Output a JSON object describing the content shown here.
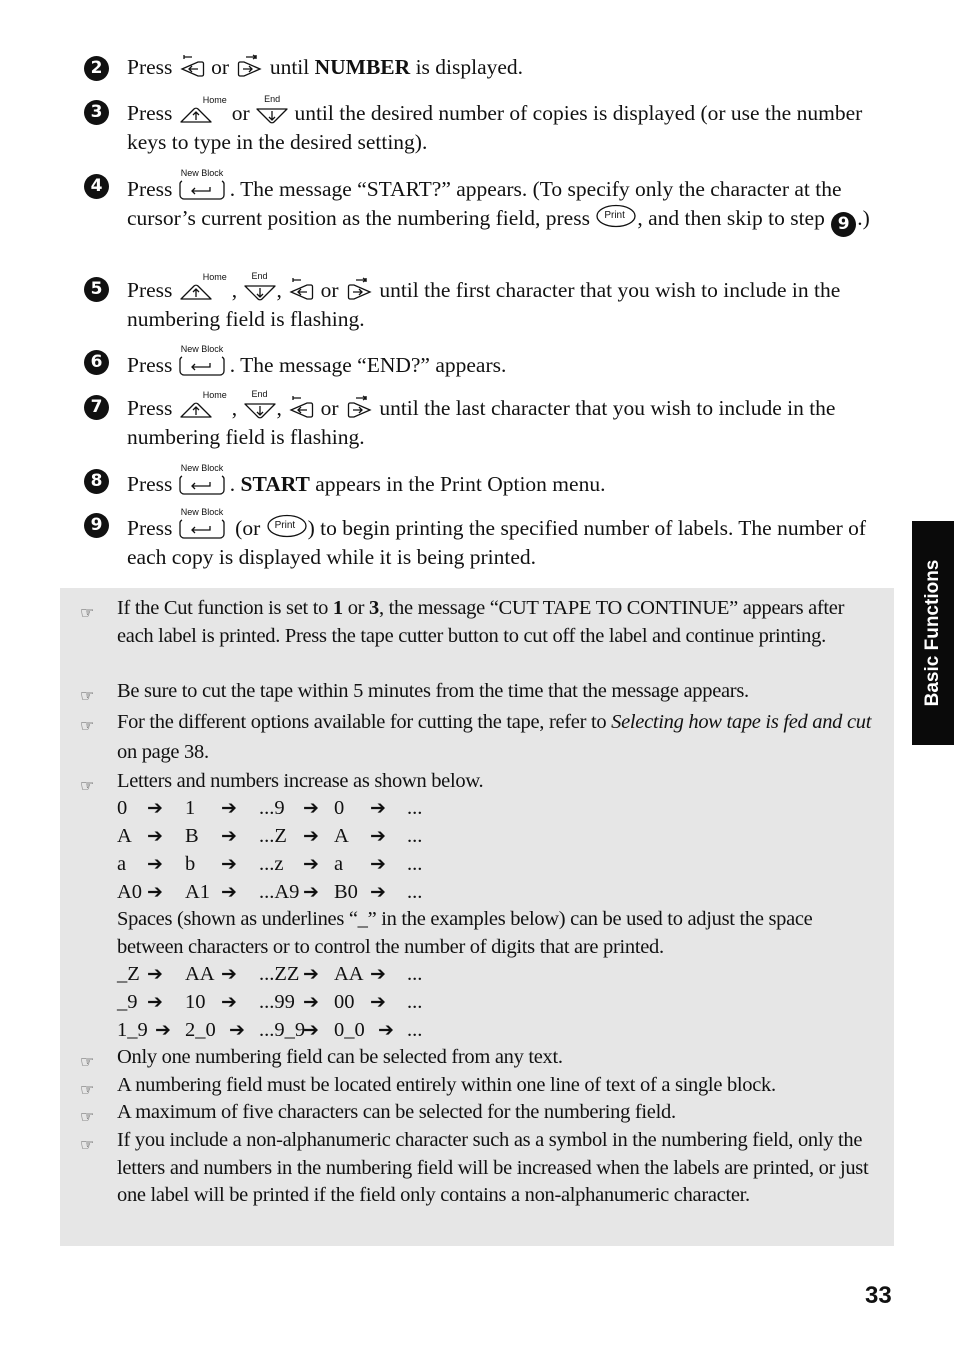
{
  "steps": [
    {
      "num": "2",
      "t1": "Press",
      "t2": "or",
      "t3": "until",
      "bold": "NUMBER",
      "t4": "is displayed."
    },
    {
      "num": "3",
      "t1": "Press",
      "t2": "or",
      "t3": "until the desired number of copies is displayed (or use the number keys to type in the desired setting)."
    },
    {
      "num": "4",
      "t1": "Press",
      "t2": ". The message “START?” appears. (To specify only the character at the cursor’s current position as the numbering field, press",
      "t3": ", and then skip to step",
      "ref": "9",
      "t4": ".)"
    },
    {
      "num": "5",
      "t1": "Press",
      "t2": ",",
      "t3": ",",
      "t4": "or",
      "t5": "until the first character that you wish to include in the numbering field is flashing."
    },
    {
      "num": "6",
      "t1": "Press",
      "t2": ". The message “END?” appears."
    },
    {
      "num": "7",
      "t1": "Press",
      "t2": ",",
      "t3": ",",
      "t4": "or",
      "t5": "until the last character that you wish to include in the numbering field is flashing."
    },
    {
      "num": "8",
      "t1": "Press",
      "t2": ".",
      "bold": "START",
      "t3": "appears in the Print Option menu."
    },
    {
      "num": "9",
      "t1": "Press",
      "t2": "(or",
      "t3": ") to begin printing the specified number of labels. The number of each copy is displayed while it is being printed."
    }
  ],
  "keys": {
    "home": "Home",
    "end": "End",
    "new_block": "New Block",
    "print": "Print"
  },
  "notes": {
    "hand_icon": "☞",
    "n1": {
      "a": "If the Cut function is set to",
      "b1": "1",
      "c": "or",
      "b2": "3",
      "d": ", the message “CUT TAPE TO CONTINUE” appears after each label is printed. Press the tape cutter button to cut off the label and continue printing."
    },
    "n2": "Be sure to cut the tape within 5 minutes from the time that the message appears.",
    "n3": {
      "a": "For the different options available for cutting the tape, refer to",
      "i": "Selecting how tape is fed and cut",
      "b": "on page 38."
    },
    "n4": "Letters and numbers increase as shown below.",
    "seq1": [
      [
        "0",
        "1",
        "...9",
        "0",
        "..."
      ],
      [
        "A",
        "B",
        "...Z",
        "A",
        "..."
      ],
      [
        "a",
        "b",
        "...z",
        "a",
        "..."
      ],
      [
        "A0",
        "A1",
        "...A9",
        "B0",
        "..."
      ]
    ],
    "spaces_text": "Spaces (shown as underlines “_” in the examples below) can be used to adjust the space between characters or to control the number of digits that are printed.",
    "seq2": [
      [
        "_Z",
        "AA",
        "...ZZ",
        "AA",
        "..."
      ],
      [
        "_9",
        "10",
        "...99",
        "00",
        "..."
      ],
      [
        "1_9",
        "2_0",
        "...9_9",
        "0_0",
        "..."
      ]
    ],
    "arrow": "➔",
    "n5": "Only one numbering field can be selected from any text.",
    "n6": "A numbering field must be located entirely within one line of text of a single block.",
    "n7": "A maximum of five characters can be selected for the numbering field.",
    "n8": "If you include a non-alphanumeric character such as a symbol in the numbering field, only the letters and numbers in the numbering field will be increased when the labels are printed, or just one label will be printed if the field only contains a non-alphanumeric character."
  },
  "side_tab": "Basic Functions",
  "page_number": "33"
}
